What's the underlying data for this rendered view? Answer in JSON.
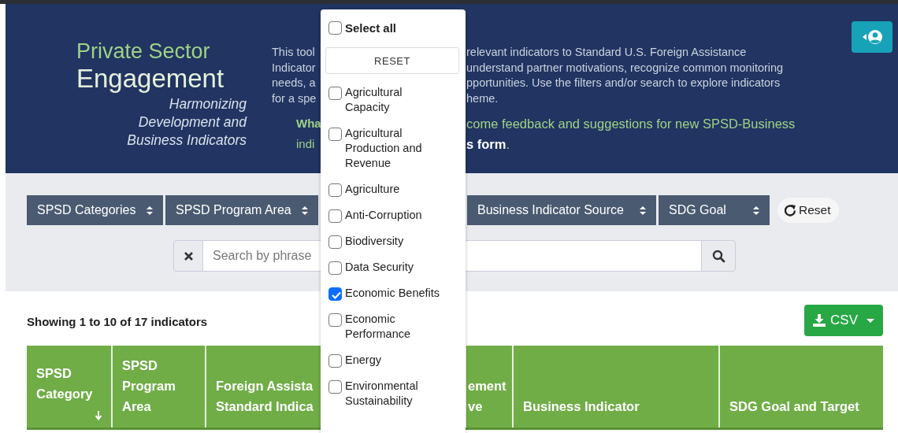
{
  "header": {
    "title_top": "Private Sector",
    "title_main": "Engagement",
    "subtitle": [
      "Harmonizing",
      "Development and",
      "Business Indicators"
    ],
    "description_left": [
      "This tool",
      "Indicator",
      "needs, a",
      "for a spe"
    ],
    "description_right": [
      "relevant indicators to Standard U.S. Foreign Assistance",
      "understand partner motivations, recognize common monitoring",
      "pportunities. Use the filters and/or search to explore indicators",
      "heme."
    ],
    "feedback_left": [
      "**Wha**",
      "indi"
    ],
    "feedback_right": [
      "come feedback and suggestions for new SPSD-Business",
      "**s form**."
    ]
  },
  "filters": [
    {
      "label": "SPSD Categories"
    },
    {
      "label": "SPSD Program Area"
    },
    {
      "label": "Business Indicator Source"
    },
    {
      "label": "SDG Goal"
    }
  ],
  "reset_button": "Reset",
  "search": {
    "placeholder": "Search by phrase"
  },
  "results_summary": "Showing 1 to 10 of 17 indicators",
  "export_button": "CSV",
  "table": {
    "columns": [
      {
        "lines": [
          "SPSD",
          "Category"
        ],
        "sorted": true
      },
      {
        "lines": [
          "SPSD",
          "Program",
          "Area"
        ],
        "sorted": false
      },
      {
        "lines": [
          "Foreign Assista",
          "Standard Indica"
        ],
        "sorted": false
      },
      {
        "lines": [
          "ement",
          "ve"
        ],
        "sorted": false
      },
      {
        "lines": [
          "Business Indicator"
        ],
        "sorted": false
      },
      {
        "lines": [
          "SDG Goal and Target"
        ],
        "sorted": false
      }
    ]
  },
  "filter_menu": {
    "select_all": {
      "label": "Select all",
      "checked": false
    },
    "reset": "RESET",
    "options": [
      {
        "label": "Agricultural Capacity",
        "checked": false
      },
      {
        "label": "Agricultural Production and Revenue",
        "checked": false
      },
      {
        "label": "Agriculture",
        "checked": false
      },
      {
        "label": "Anti-Corruption",
        "checked": false
      },
      {
        "label": "Biodiversity",
        "checked": false
      },
      {
        "label": "Data Security",
        "checked": false
      },
      {
        "label": "Economic Benefits",
        "checked": true
      },
      {
        "label": "Economic Performance",
        "checked": false
      },
      {
        "label": "Energy",
        "checked": false
      },
      {
        "label": "Environmental Sustainability",
        "checked": false
      }
    ]
  }
}
